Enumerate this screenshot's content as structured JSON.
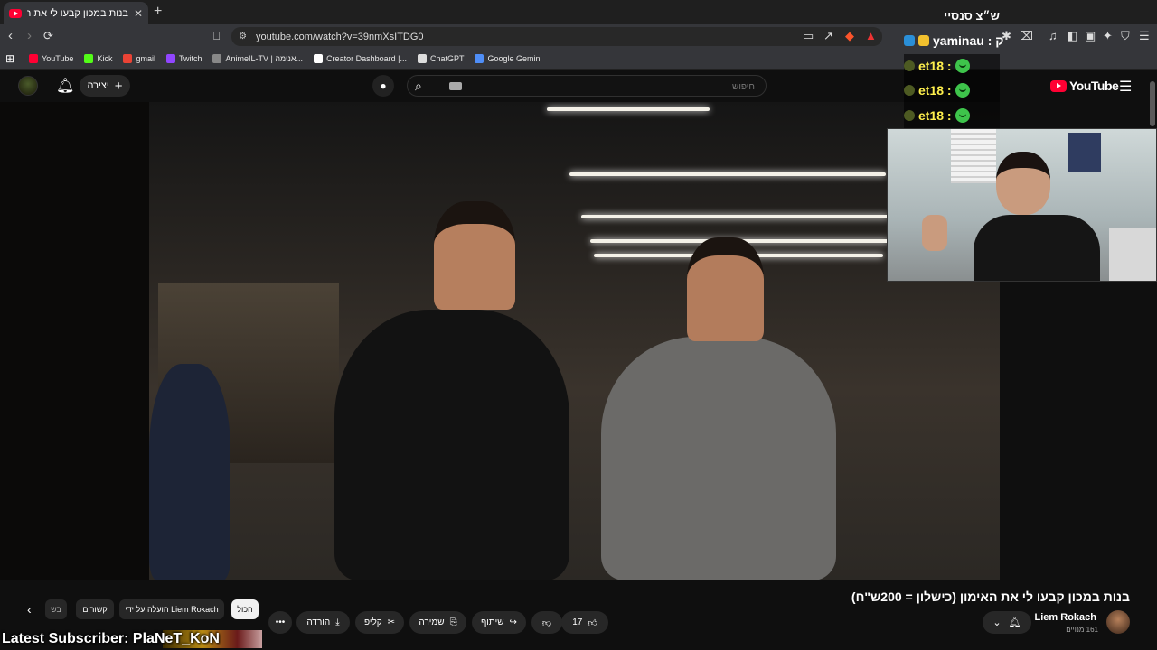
{
  "browser": {
    "tab_title": "בנות במכון קבעו לי את האימון (כ",
    "url": "youtube.com/watch?v=39nmXsITDG0",
    "bookmarks": [
      {
        "label": "YouTube",
        "color": "#ff0033"
      },
      {
        "label": "Kick",
        "color": "#53fc18"
      },
      {
        "label": "gmail",
        "color": "#ea4335"
      },
      {
        "label": "Twitch",
        "color": "#9146ff"
      },
      {
        "label": "AnimeIL-TV | אנימה...",
        "color": "#888888"
      },
      {
        "label": "Creator Dashboard |...",
        "color": "#ffffff"
      },
      {
        "label": "ChatGPT",
        "color": "#dddddd"
      },
      {
        "label": "Google Gemini",
        "color": "#4f8ef7"
      }
    ]
  },
  "youtube": {
    "create_label": "יצירה",
    "search_placeholder": "חיפוש",
    "logo_text": "YouTube"
  },
  "chat": {
    "header_text": "ש״צ סנסיי",
    "users": [
      {
        "name": "yaminau : ק",
        "color": "#f5f5f5"
      },
      {
        "name": "et18 :",
        "color": "#fff04d"
      },
      {
        "name": "et18 :",
        "color": "#fff04d"
      },
      {
        "name": "et18 :",
        "color": "#fff04d"
      }
    ]
  },
  "video": {
    "title": "בנות במכון קבעו לי את האימון (כישלון = 200ש\"ח)",
    "channel_name": "Liem Rokach",
    "subscribers": "161 מנויים"
  },
  "actions": {
    "like_count": "17",
    "share_label": "שיתוף",
    "save_label": "שמירה",
    "clip_label": "קליפ",
    "download_label": "הורדה"
  },
  "chips": {
    "all": "הכול",
    "uploaded_by": "הועלה על ידי Liem Rokach",
    "related": "קשורים",
    "partial": "בש"
  },
  "overlay": {
    "latest_subscriber": "Latest Subscriber: PlaNeT_KoN"
  },
  "colors": {
    "accent": "#ff0033",
    "background": "#0f0f0f"
  }
}
